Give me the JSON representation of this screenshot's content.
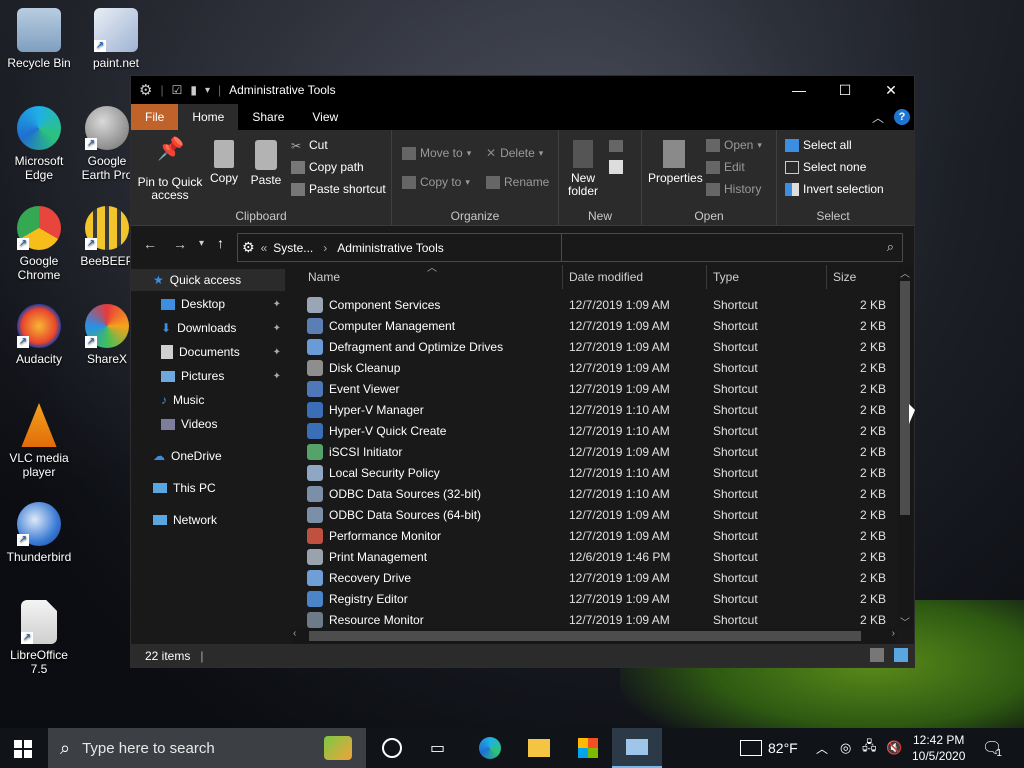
{
  "desktop": {
    "icons": [
      {
        "label": "Recycle Bin",
        "color": "#8fb7d9"
      },
      {
        "label": "paint.net",
        "color": "#cfd7e6"
      },
      {
        "label": "Microsoft Edge",
        "color": "#2b9fd8"
      },
      {
        "label": "Google Earth Pro",
        "color": "#8a8a8a"
      },
      {
        "label": "Google Chrome",
        "color": "#e8453c"
      },
      {
        "label": "BeeBEEP",
        "color": "#f2c52c"
      },
      {
        "label": "Audacity",
        "color": "#f6a21c"
      },
      {
        "label": "ShareX",
        "color": "#e63b3b"
      },
      {
        "label": "VLC media player",
        "color": "#f08a0a"
      },
      {
        "label": "Thunderbird",
        "color": "#3a7bd5"
      },
      {
        "label": "LibreOffice 7.5",
        "color": "#e9e9e9"
      }
    ]
  },
  "window": {
    "title": "Administrative Tools",
    "tabs": [
      "File",
      "Home",
      "Share",
      "View"
    ],
    "ribbon": {
      "clipboard": {
        "pin_label": "Pin to Quick access",
        "copy": "Copy",
        "paste": "Paste",
        "cut": "Cut",
        "copy_path": "Copy path",
        "paste_shortcut": "Paste shortcut",
        "group": "Clipboard"
      },
      "organize": {
        "move_to": "Move to",
        "copy_to": "Copy to",
        "delete": "Delete",
        "rename": "Rename",
        "group": "Organize"
      },
      "new": {
        "new_folder": "New folder",
        "group": "New"
      },
      "open": {
        "properties": "Properties",
        "open": "Open",
        "edit": "Edit",
        "history": "History",
        "group": "Open"
      },
      "select": {
        "select_all": "Select all",
        "select_none": "Select none",
        "invert_selection": "Invert selection",
        "group": "Select"
      }
    },
    "address": {
      "crumb1": "Syste...",
      "crumb2": "Administrative Tools",
      "prefix": "«"
    },
    "nav": {
      "quick_access": "Quick access",
      "desktop": "Desktop",
      "downloads": "Downloads",
      "documents": "Documents",
      "pictures": "Pictures",
      "music": "Music",
      "videos": "Videos",
      "onedrive": "OneDrive",
      "this_pc": "This PC",
      "network": "Network"
    },
    "columns": {
      "name": "Name",
      "date": "Date modified",
      "type": "Type",
      "size": "Size"
    },
    "files": [
      {
        "name": "Component Services",
        "date": "12/7/2019 1:09 AM",
        "type": "Shortcut",
        "size": "2 KB",
        "color": "#9aa6b5"
      },
      {
        "name": "Computer Management",
        "date": "12/7/2019 1:09 AM",
        "type": "Shortcut",
        "size": "2 KB",
        "color": "#5b7fb5"
      },
      {
        "name": "Defragment and Optimize Drives",
        "date": "12/7/2019 1:09 AM",
        "type": "Shortcut",
        "size": "2 KB",
        "color": "#6a9bd8"
      },
      {
        "name": "Disk Cleanup",
        "date": "12/7/2019 1:09 AM",
        "type": "Shortcut",
        "size": "2 KB",
        "color": "#8e8e8e"
      },
      {
        "name": "Event Viewer",
        "date": "12/7/2019 1:09 AM",
        "type": "Shortcut",
        "size": "2 KB",
        "color": "#4f78b8"
      },
      {
        "name": "Hyper-V Manager",
        "date": "12/7/2019 1:10 AM",
        "type": "Shortcut",
        "size": "2 KB",
        "color": "#3a6fb8"
      },
      {
        "name": "Hyper-V Quick Create",
        "date": "12/7/2019 1:10 AM",
        "type": "Shortcut",
        "size": "2 KB",
        "color": "#3a6fb8"
      },
      {
        "name": "iSCSI Initiator",
        "date": "12/7/2019 1:09 AM",
        "type": "Shortcut",
        "size": "2 KB",
        "color": "#55a36a"
      },
      {
        "name": "Local Security Policy",
        "date": "12/7/2019 1:10 AM",
        "type": "Shortcut",
        "size": "2 KB",
        "color": "#8fa7c2"
      },
      {
        "name": "ODBC Data Sources (32-bit)",
        "date": "12/7/2019 1:10 AM",
        "type": "Shortcut",
        "size": "2 KB",
        "color": "#7b8fa8"
      },
      {
        "name": "ODBC Data Sources (64-bit)",
        "date": "12/7/2019 1:09 AM",
        "type": "Shortcut",
        "size": "2 KB",
        "color": "#7b8fa8"
      },
      {
        "name": "Performance Monitor",
        "date": "12/7/2019 1:09 AM",
        "type": "Shortcut",
        "size": "2 KB",
        "color": "#c0503f"
      },
      {
        "name": "Print Management",
        "date": "12/6/2019 1:46 PM",
        "type": "Shortcut",
        "size": "2 KB",
        "color": "#9aa2ad"
      },
      {
        "name": "Recovery Drive",
        "date": "12/7/2019 1:09 AM",
        "type": "Shortcut",
        "size": "2 KB",
        "color": "#6f9fd6"
      },
      {
        "name": "Registry Editor",
        "date": "12/7/2019 1:09 AM",
        "type": "Shortcut",
        "size": "2 KB",
        "color": "#4c84c9"
      },
      {
        "name": "Resource Monitor",
        "date": "12/7/2019 1:09 AM",
        "type": "Shortcut",
        "size": "2 KB",
        "color": "#6c7a8a"
      }
    ],
    "status": {
      "items": "22 items"
    }
  },
  "taskbar": {
    "search_placeholder": "Type here to search",
    "temperature": "82°F",
    "time": "12:42 PM",
    "date": "10/5/2020",
    "notification_count": "1"
  },
  "colors": {
    "accent": "#c0632b",
    "window_bg": "#191919",
    "ribbon_bg": "#2b2b2b",
    "taskbar_bg": "#101418"
  }
}
